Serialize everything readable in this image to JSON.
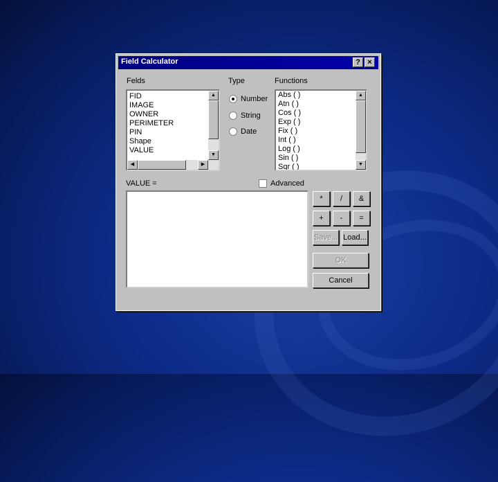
{
  "window": {
    "title": "Field Calculator",
    "help_label": "?",
    "close_label": "×"
  },
  "fields": {
    "label": "Felds",
    "items": [
      "FID",
      "IMAGE",
      "OWNER",
      "PERIMETER",
      "PIN",
      "Shape",
      "VALUE"
    ]
  },
  "type": {
    "label": "Type",
    "options": [
      "Number",
      "String",
      "Date"
    ],
    "selected": "Number"
  },
  "functions": {
    "label": "Functions",
    "items": [
      "Abs ( )",
      "Atn ( )",
      "Cos ( )",
      "Exp ( )",
      "Fix ( )",
      "Int ( )",
      "Log ( )",
      "Sin ( )",
      "Sqr ( )"
    ]
  },
  "expression": {
    "label": "VALUE =",
    "value": ""
  },
  "advanced": {
    "label": "Advanced",
    "checked": false
  },
  "operators": [
    "*",
    "/",
    "&",
    "+",
    "-",
    "="
  ],
  "buttons": {
    "save": "Save...",
    "load": "Load...",
    "ok": "OK",
    "cancel": "Cancel"
  },
  "icons": {
    "up": "▲",
    "down": "▼",
    "left": "◀",
    "right": "▶"
  }
}
